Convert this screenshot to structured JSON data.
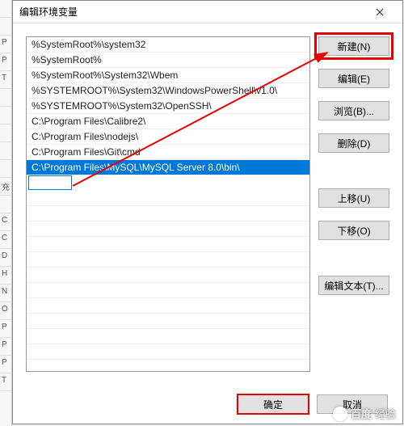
{
  "window": {
    "title": "编辑环境变量"
  },
  "path_entries": [
    "%SystemRoot%\\system32",
    "%SystemRoot%",
    "%SystemRoot%\\System32\\Wbem",
    "%SYSTEMROOT%\\System32\\WindowsPowerShell\\v1.0\\",
    "%SYSTEMROOT%\\System32\\OpenSSH\\",
    "C:\\Program Files\\Calibre2\\",
    "C:\\Program Files\\nodejs\\",
    "C:\\Program Files\\Git\\cmd",
    "C:\\Program Files\\MySQL\\MySQL Server 8.0\\bin\\"
  ],
  "selected_index": 8,
  "editing_new_row": true,
  "buttons": {
    "new": "新建(N)",
    "edit": "编辑(E)",
    "browse": "浏览(B)...",
    "delete": "删除(D)",
    "move_up": "上移(U)",
    "move_down": "下移(O)",
    "edit_text": "编辑文本(T)...",
    "ok": "确定",
    "cancel": "取消"
  },
  "watermark": {
    "brand_cn": "百度",
    "brand_sub": "经验"
  },
  "colors": {
    "highlight": "#e60000",
    "selection": "#0078d7"
  }
}
